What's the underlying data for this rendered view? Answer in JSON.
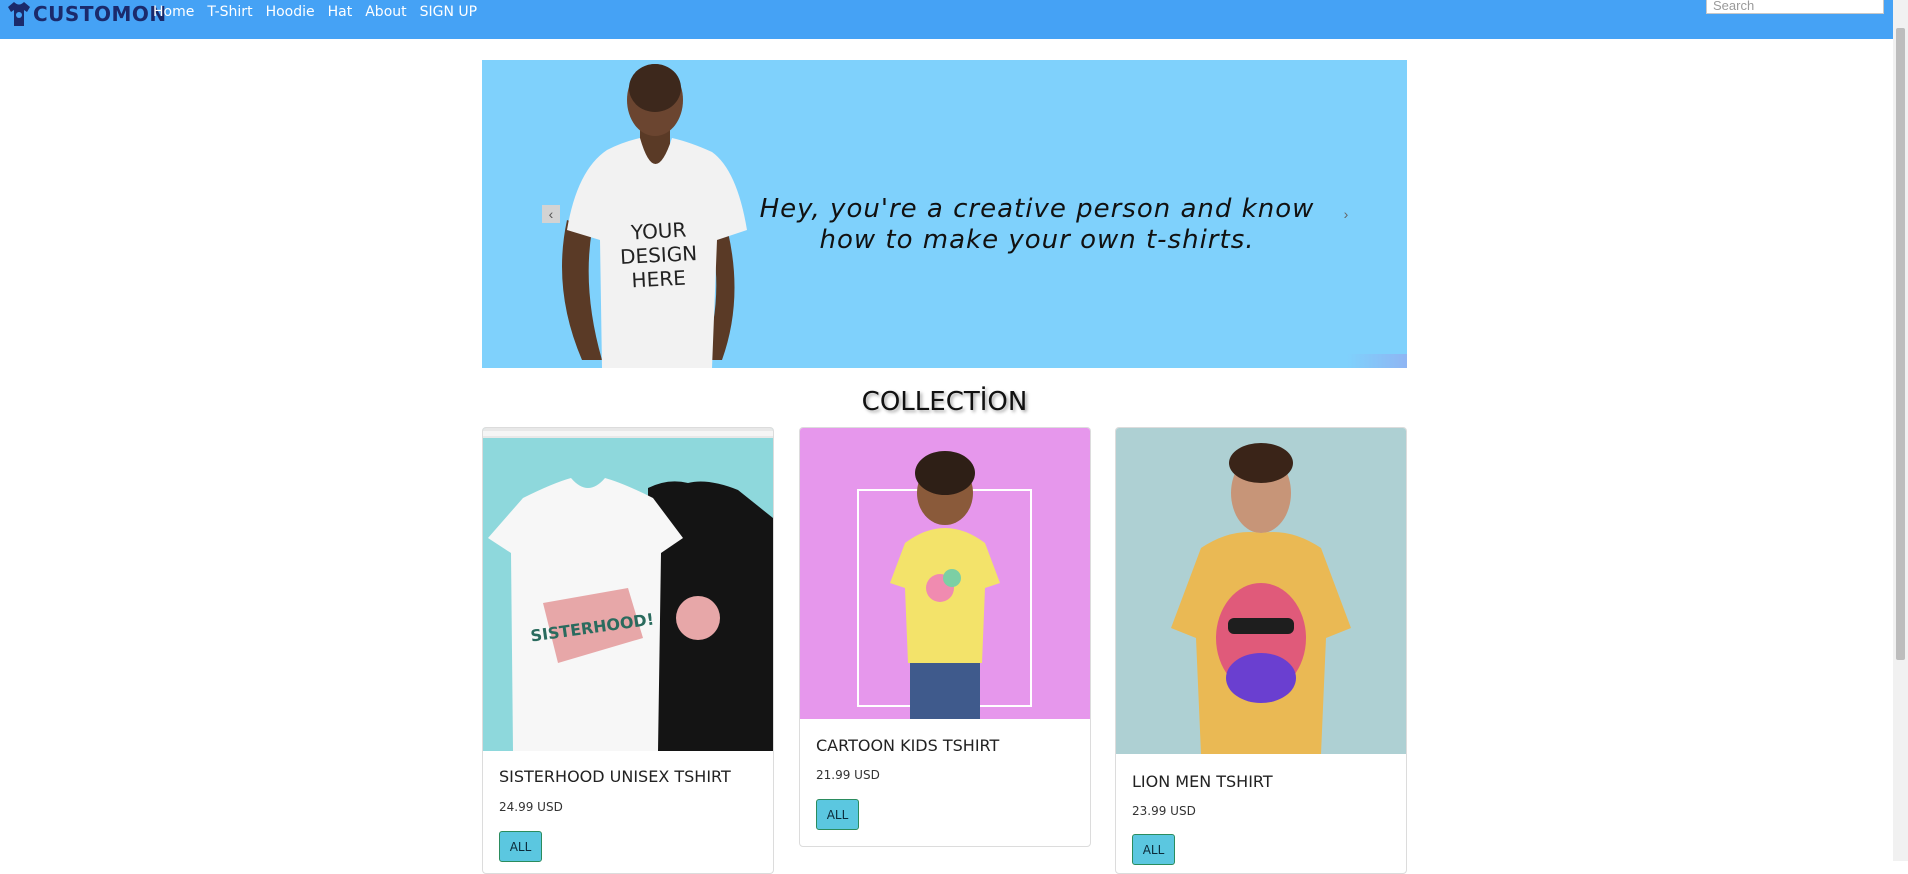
{
  "brand": {
    "name": "CUSTOMON"
  },
  "nav": {
    "links": [
      {
        "label": "Home"
      },
      {
        "label": "T-Shirt"
      },
      {
        "label": "Hoodie"
      },
      {
        "label": "Hat"
      },
      {
        "label": "About"
      },
      {
        "label": "SIGN UP"
      }
    ],
    "search_placeholder": "Search"
  },
  "hero": {
    "shirt_text": "YOUR DESIGN HERE",
    "headline_line1": "Hey, you're a creative person and know",
    "headline_line2": "how to make your own t-shirts.",
    "prev_icon": "chevron-left-icon",
    "next_icon": "chevron-right-icon"
  },
  "collection": {
    "title": "COLLECTİON",
    "products": [
      {
        "name": "SISTERHOOD UNISEX TSHIRT",
        "price": "24.99 USD",
        "button": "ALL",
        "print_text": "SISTERHOOD!"
      },
      {
        "name": "CARTOON KIDS TSHIRT",
        "price": "21.99 USD",
        "button": "ALL"
      },
      {
        "name": "LION MEN TSHIRT",
        "price": "23.99 USD",
        "button": "ALL"
      }
    ]
  },
  "colors": {
    "navbar": "#45a2f5",
    "hero_bg": "#7fd1fc",
    "button": "#5bc7e0",
    "card1_bg": "#8ed8dc",
    "card2_bg": "#e697ec",
    "card3_bg": "#aed0d3"
  }
}
